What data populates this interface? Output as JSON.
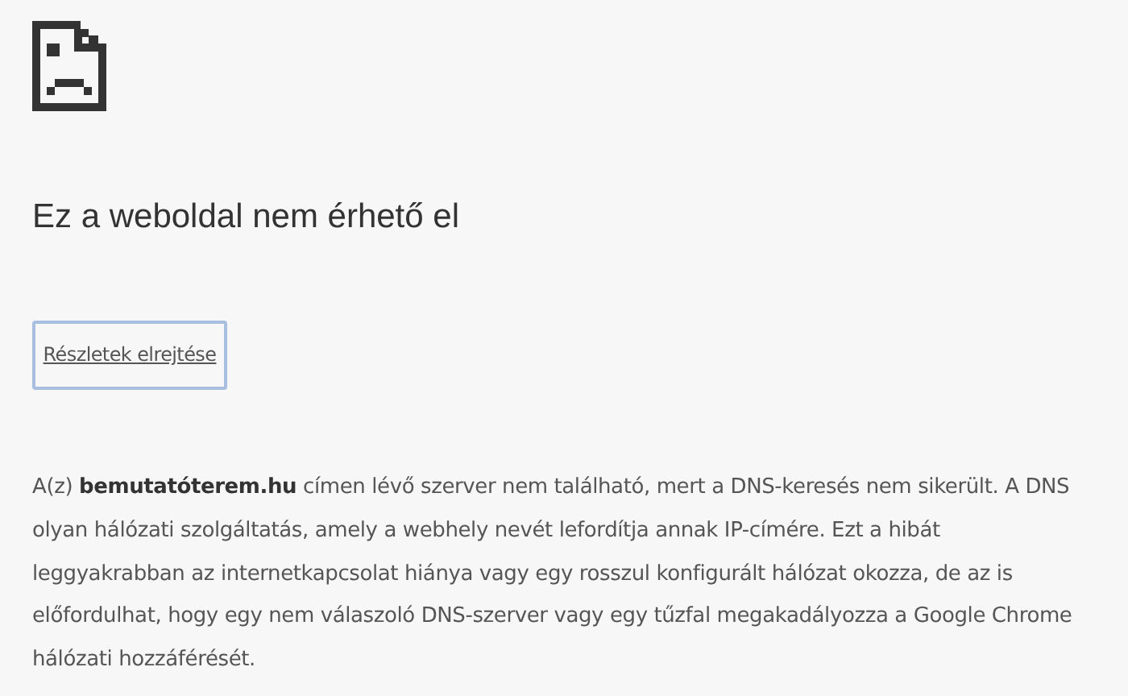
{
  "title": "Ez a weboldal nem érhető el",
  "details_button": {
    "label": "Részletek elrejtése"
  },
  "explanation": "A(z) **bemutatóterem.hu** címen lévő szerver nem található, mert a DNS-keresés nem sikerült. A DNS olyan hálózati szolgáltatás, amely a webhely nevét lefordítja annak IP-címére. Ezt a hibát leggyakrabban az internetkapcsolat hiánya vagy egy rosszul konfigurált hálózat okozza, de az is előfordulhat, hogy egy nem válaszoló DNS-szerver vagy egy tűzfal megakadályozza a Google Chrome hálózati hozzáférését."
}
